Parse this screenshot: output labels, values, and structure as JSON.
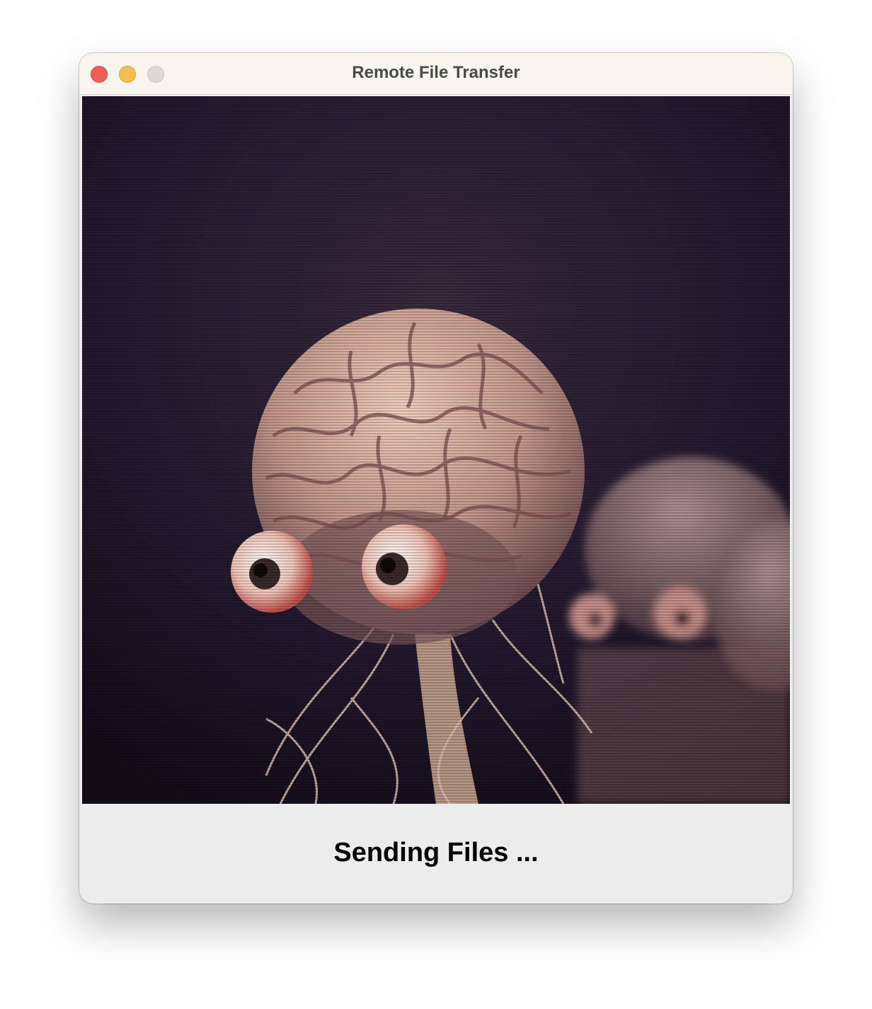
{
  "window": {
    "title": "Remote File Transfer",
    "controls": [
      "close-button",
      "minimize-button",
      "zoom-button"
    ]
  },
  "status": {
    "message": "Sending Files ..."
  },
  "colors": {
    "close": "#ee5f57",
    "minimize": "#f6be4f",
    "zoom_inactive": "#dcdad5",
    "titlebar": "#f8f5ef",
    "panel": "#ececec"
  }
}
